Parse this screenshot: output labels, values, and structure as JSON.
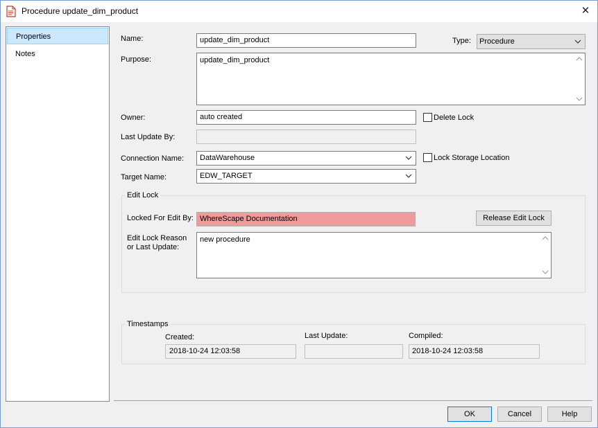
{
  "window": {
    "title": "Procedure update_dim_product",
    "icon": "procedure-document-icon",
    "close_glyph": "✕"
  },
  "nav": {
    "items": [
      {
        "label": "Properties",
        "selected": true
      },
      {
        "label": "Notes",
        "selected": false
      }
    ]
  },
  "form": {
    "name_label": "Name:",
    "name_value": "update_dim_product",
    "type_label": "Type:",
    "type_value": "Procedure",
    "purpose_label": "Purpose:",
    "purpose_value": "update_dim_product",
    "owner_label": "Owner:",
    "owner_value": "auto created",
    "delete_lock_label": "Delete Lock",
    "delete_lock_checked": false,
    "last_update_by_label": "Last Update By:",
    "last_update_by_value": "",
    "connection_label": "Connection Name:",
    "connection_value": "DataWarehouse",
    "lock_storage_label": "Lock Storage Location",
    "lock_storage_checked": false,
    "target_label": "Target Name:",
    "target_value": "EDW_TARGET"
  },
  "edit_lock": {
    "group_title": "Edit Lock",
    "locked_by_label": "Locked For Edit By:",
    "locked_by_value": "WhereScape Documentation",
    "locked_by_color": "#f09b9b",
    "release_button": "Release Edit Lock",
    "reason_label_line1": "Edit Lock Reason",
    "reason_label_line2": "or Last Update:",
    "reason_value": "new procedure"
  },
  "timestamps": {
    "group_title": "Timestamps",
    "created_label": "Created:",
    "created_value": "2018-10-24 12:03:58",
    "last_update_label": "Last Update:",
    "last_update_value": "",
    "compiled_label": "Compiled:",
    "compiled_value": "2018-10-24 12:03:58"
  },
  "buttons": {
    "ok": "OK",
    "cancel": "Cancel",
    "help": "Help"
  }
}
